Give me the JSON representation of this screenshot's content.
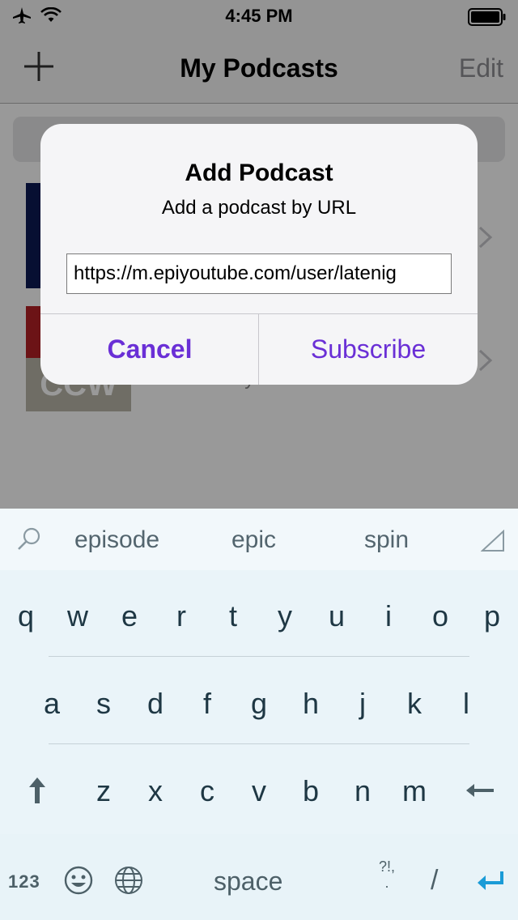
{
  "status": {
    "time": "4:45 PM"
  },
  "nav": {
    "title": "My Podcasts",
    "edit_label": "Edit"
  },
  "list": {
    "subtitle": "Wednesday",
    "art2_text": "CCW"
  },
  "alert": {
    "title": "Add Podcast",
    "message": "Add a podcast by URL",
    "url_value": "https://m.epiyoutube.com/user/latenig",
    "cancel_label": "Cancel",
    "subscribe_label": "Subscribe"
  },
  "keyboard": {
    "suggestions": [
      "episode",
      "epic",
      "spin"
    ],
    "row1": [
      "q",
      "w",
      "e",
      "r",
      "t",
      "y",
      "u",
      "i",
      "o",
      "p"
    ],
    "row2": [
      "a",
      "s",
      "d",
      "f",
      "g",
      "h",
      "j",
      "k",
      "l"
    ],
    "row3": [
      "z",
      "x",
      "c",
      "v",
      "b",
      "n",
      "m"
    ],
    "numbers_label": "123",
    "space_label": "space",
    "punct_label": "?!,",
    "slash_label": "/"
  },
  "colors": {
    "accent": "#6a2fd6",
    "return_key": "#1a9bd7"
  }
}
